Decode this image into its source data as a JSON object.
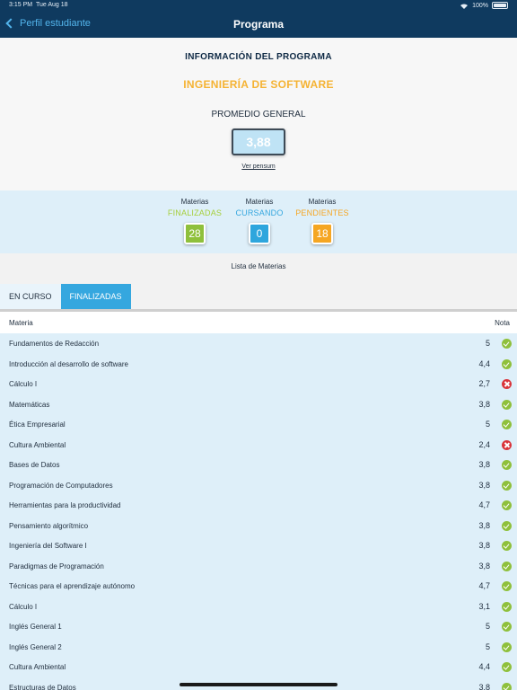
{
  "status": {
    "time": "3:15 PM",
    "date": "Tue Aug 18",
    "battery": "100%"
  },
  "nav": {
    "back_label": "Perfil estudiante",
    "title": "Programa"
  },
  "info": {
    "heading": "INFORMACIÓN DEL PROGRAMA",
    "program": "INGENIERÍA DE SOFTWARE",
    "average_label": "PROMEDIO GENERAL",
    "average_value": "3,88",
    "pensum_link": "Ver pensum"
  },
  "counters": [
    {
      "small": "Materias",
      "label": "FINALIZADAS",
      "value": "28",
      "color": "#8fc03b"
    },
    {
      "small": "Materias",
      "label": "CURSANDO",
      "value": "0",
      "color": "#2ea6dd"
    },
    {
      "small": "Materias",
      "label": "PENDIENTES",
      "value": "18",
      "color": "#f5a623"
    }
  ],
  "list_title": "Lista de Materias",
  "tabs": [
    {
      "label": "EN CURSO",
      "active": false
    },
    {
      "label": "FINALIZADAS",
      "active": true
    }
  ],
  "table": {
    "col_subject": "Materia",
    "col_grade": "Nota",
    "rows": [
      {
        "name": "Fundamentos de Redacción",
        "grade": "5",
        "status": "passed"
      },
      {
        "name": "Introducción al desarrollo de software",
        "grade": "4,4",
        "status": "passed"
      },
      {
        "name": "Cálculo I",
        "grade": "2,7",
        "status": "failed"
      },
      {
        "name": "Matemáticas",
        "grade": "3,8",
        "status": "passed"
      },
      {
        "name": "Ética Empresarial",
        "grade": "5",
        "status": "passed"
      },
      {
        "name": "Cultura Ambiental",
        "grade": "2,4",
        "status": "failed"
      },
      {
        "name": "Bases de Datos",
        "grade": "3,8",
        "status": "passed"
      },
      {
        "name": "Programación de Computadores",
        "grade": "3,8",
        "status": "passed"
      },
      {
        "name": "Herramientas para la productividad",
        "grade": "4,7",
        "status": "passed"
      },
      {
        "name": "Pensamiento algorítmico",
        "grade": "3,8",
        "status": "passed"
      },
      {
        "name": "Ingeniería del Software I",
        "grade": "3,8",
        "status": "passed"
      },
      {
        "name": "Paradigmas de Programación",
        "grade": "3,8",
        "status": "passed"
      },
      {
        "name": "Técnicas para el aprendizaje autónomo",
        "grade": "4,7",
        "status": "passed"
      },
      {
        "name": "Cálculo I",
        "grade": "3,1",
        "status": "passed"
      },
      {
        "name": "Inglés General 1",
        "grade": "5",
        "status": "passed"
      },
      {
        "name": "Inglés General 2",
        "grade": "5",
        "status": "passed"
      },
      {
        "name": "Cultura Ambiental",
        "grade": "4,4",
        "status": "passed"
      },
      {
        "name": "Estructuras de Datos",
        "grade": "3,8",
        "status": "passed"
      }
    ]
  }
}
